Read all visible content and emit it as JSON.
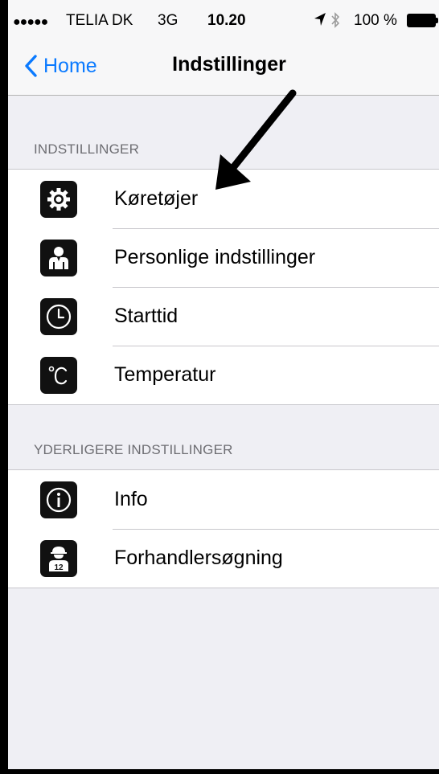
{
  "status_bar": {
    "signal": "●●●●●",
    "carrier": "TELIA DK",
    "network": "3G",
    "time": "10.20",
    "battery": "100 %"
  },
  "nav": {
    "back_label": "Home",
    "title": "Indstillinger"
  },
  "sections": [
    {
      "header": "INDSTILLINGER",
      "items": [
        {
          "label": "Køretøjer",
          "icon": "gear-icon"
        },
        {
          "label": "Personlige indstillinger",
          "icon": "person-icon"
        },
        {
          "label": "Starttid",
          "icon": "clock-icon"
        },
        {
          "label": "Temperatur",
          "icon": "celsius-icon"
        }
      ]
    },
    {
      "header": "YDERLIGERE INDSTILLINGER",
      "items": [
        {
          "label": "Info",
          "icon": "info-icon"
        },
        {
          "label": "Forhandlersøgning",
          "icon": "dealer-icon"
        }
      ]
    }
  ],
  "colors": {
    "accent": "#0a7aff",
    "background": "#efeff4",
    "icon_tile": "#111111"
  }
}
